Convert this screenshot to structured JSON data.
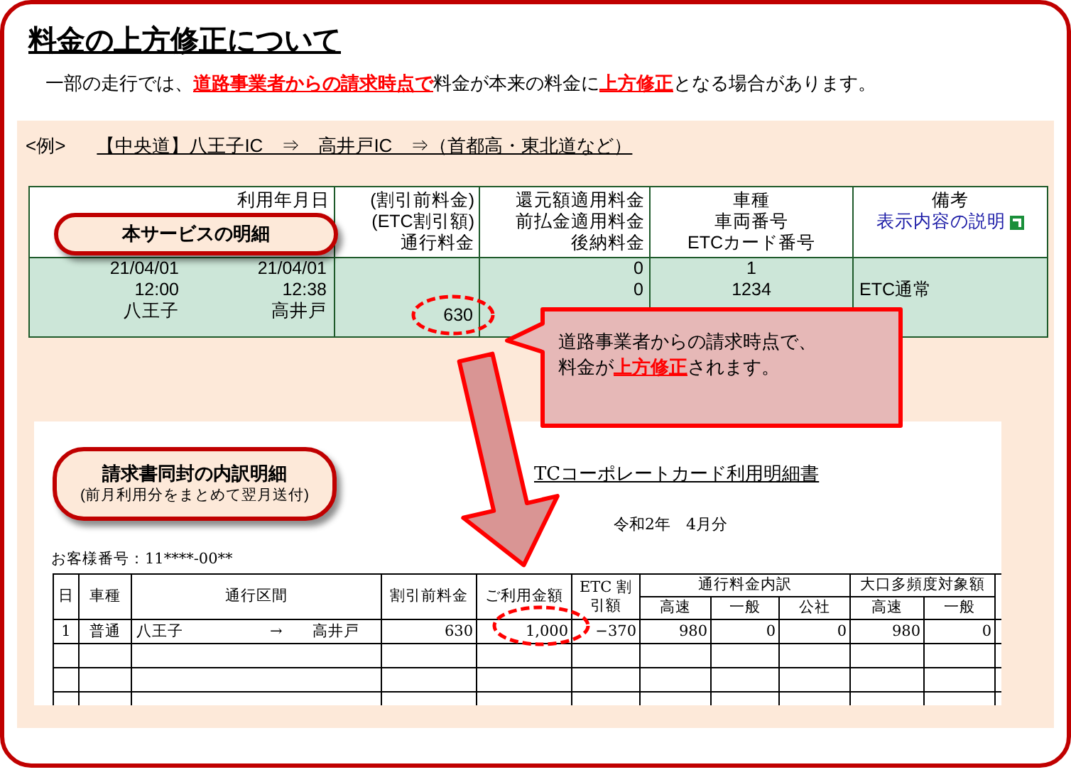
{
  "title": "料金の上方修正について",
  "intro": "一部の走行では、**道路事業者からの請求時点で**料金が本来の料金に**上方修正**となる場合があります。",
  "example": {
    "label": "<例>",
    "route": "【中央道】八王子IC　⇒　高井戸IC　⇒（首都高・東北道など）"
  },
  "service_table": {
    "columns": [
      {
        "lines": [
          "利用年月日"
        ]
      },
      {
        "lines": [
          "(割引前料金)",
          "(ETC割引額)",
          "通行料金"
        ]
      },
      {
        "lines": [
          "還元額適用料金",
          "前払金適用料金",
          "後納料金"
        ]
      },
      {
        "lines": [
          "車種",
          "車両番号",
          "ETCカード番号"
        ]
      },
      {
        "lines": [
          "備考"
        ],
        "link": "表示内容の説明"
      }
    ],
    "rows": [
      {
        "entry": [
          "21/04/01",
          "12:00",
          "八王子"
        ],
        "exit": [
          "21/04/01",
          "12:38",
          "高井戸"
        ],
        "toll": "630",
        "refund": [
          "0",
          "0"
        ],
        "vehicle": [
          "1",
          "1234"
        ],
        "note": "ETC通常"
      }
    ]
  },
  "service_label": "本サービスの明細",
  "bubble": [
    "道路事業者からの請求時点で、",
    "料金が**上方修正**されます。"
  ],
  "invoice": {
    "label": "請求書同封の内訳明細",
    "label_note": "(前月利用分をまとめて翌月送付)",
    "doc_title": "TCコーポレートカード利用明細書",
    "period": "令和2年　4月分",
    "customer": "お客様番号：11****-00**",
    "headers": [
      "日",
      "車種",
      "通行区間",
      "割引前料金",
      "ご利用金額",
      "ETC 割引額"
    ],
    "groups": [
      {
        "label": "通行料金内訳",
        "subs": [
          "高速",
          "一般",
          "公社"
        ]
      },
      {
        "label": "大口多頻度対象額",
        "subs": [
          "高速",
          "一般"
        ]
      }
    ],
    "rows": [
      {
        "kind": "entry",
        "cells": [
          "1",
          "普通"
        ],
        "from": "八王子",
        "arrow": "→",
        "to": "高井戸",
        "amounts": [
          "630",
          "1,000",
          "−370",
          "980",
          "0",
          "0",
          "980",
          "0"
        ]
      },
      {
        "kind": "blank"
      },
      {
        "kind": "blank"
      },
      {
        "kind": "blank"
      }
    ]
  }
}
